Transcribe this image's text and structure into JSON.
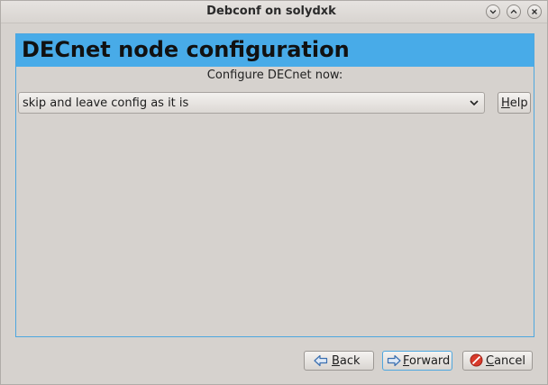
{
  "window": {
    "title": "Debconf on solydxk"
  },
  "header": {
    "title": "DECnet node configuration"
  },
  "question": {
    "label": "Configure DECnet now:"
  },
  "select": {
    "value": "skip and leave config as it is"
  },
  "buttons": {
    "help": "Help",
    "back": "Back",
    "forward": "Forward",
    "cancel": "Cancel"
  },
  "icons": {
    "minimize": "chevron-down-icon",
    "maximize": "chevron-up-icon",
    "close": "close-icon",
    "back": "arrow-left-icon",
    "forward": "arrow-right-icon",
    "cancel": "stop-icon",
    "dropdown": "chevron-down-icon"
  },
  "colors": {
    "accent": "#48abe8",
    "window_bg": "#d6d2ce",
    "cancel_icon": "#d93a2b",
    "arrow_icon": "#3a6fb0"
  }
}
